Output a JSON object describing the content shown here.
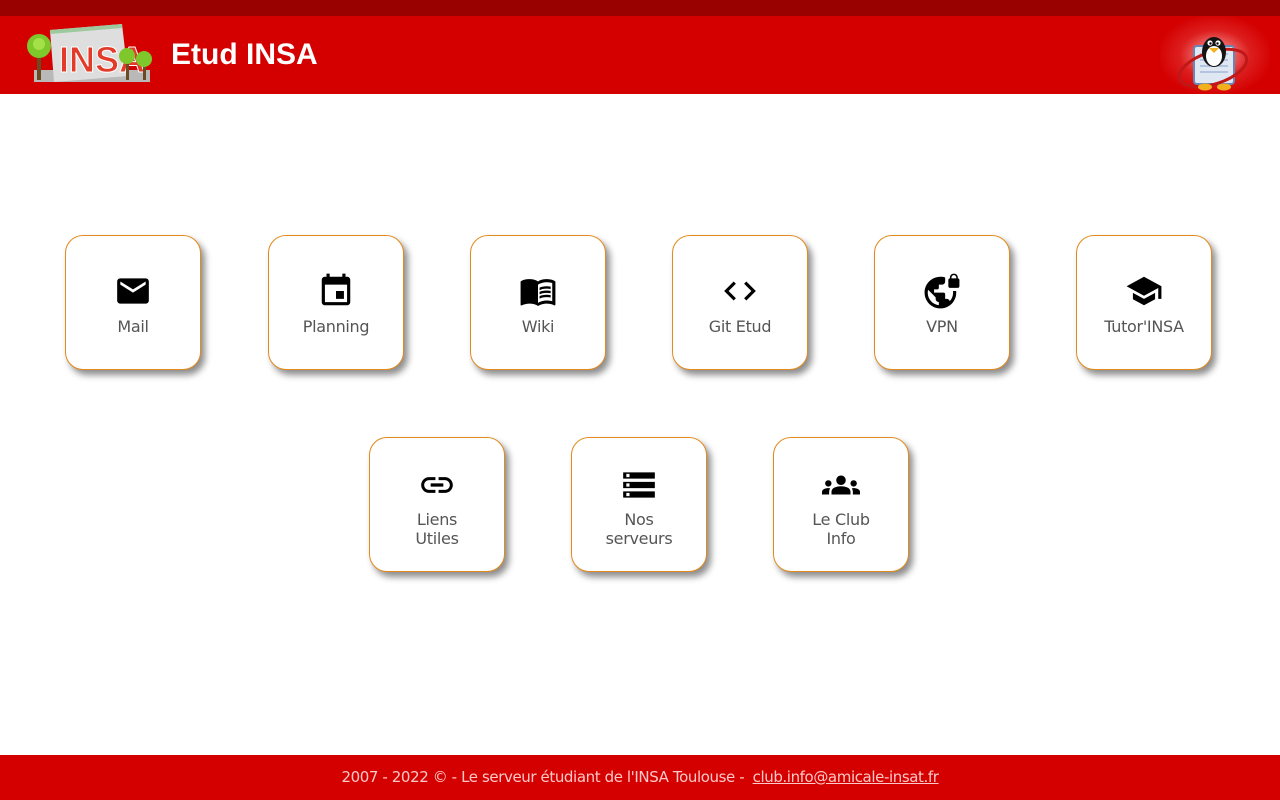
{
  "header": {
    "title": "Etud INSA",
    "logo_text": "INSA"
  },
  "tiles": [
    {
      "label": "Mail",
      "icon": "mail-icon"
    },
    {
      "label": "Planning",
      "icon": "calendar-icon"
    },
    {
      "label": "Wiki",
      "icon": "book-icon"
    },
    {
      "label": "Git Etud",
      "icon": "code-icon"
    },
    {
      "label": "VPN",
      "icon": "vpn-globe-lock-icon"
    },
    {
      "label": "Tutor'INSA",
      "icon": "graduation-cap-icon"
    },
    {
      "label_line1": "Liens",
      "label_line2": "Utiles",
      "icon": "link-icon"
    },
    {
      "label_line1": "Nos",
      "label_line2": "serveurs",
      "icon": "servers-icon"
    },
    {
      "label_line1": "Le Club",
      "label_line2": "Info",
      "icon": "group-icon"
    }
  ],
  "footer": {
    "text": "2007 - 2022 © - Le serveur étudiant de l'INSA Toulouse - ",
    "email": "club.info@amicale-insat.fr"
  },
  "colors": {
    "header_red": "#d40000",
    "top_strip": "#990000",
    "tile_border": "#e38a1c",
    "label_gray": "#555555",
    "footer_text": "#ffc8c8"
  }
}
